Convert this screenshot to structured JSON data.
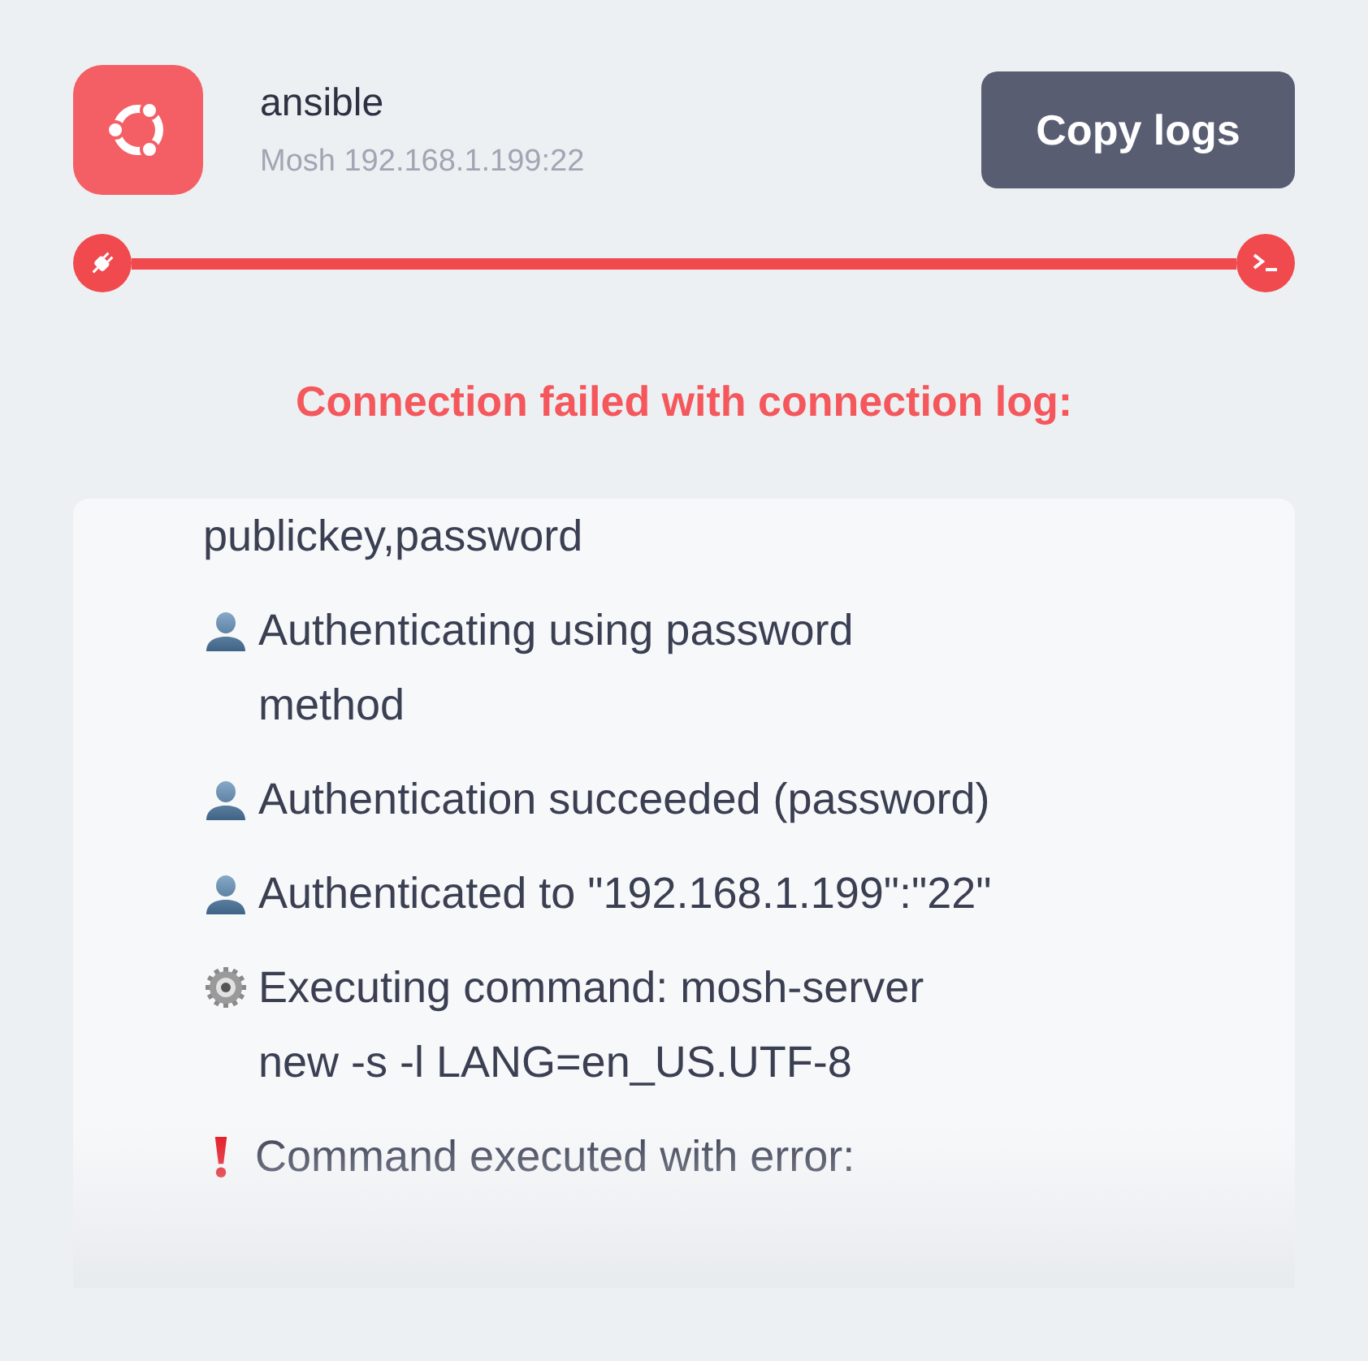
{
  "host": {
    "name": "ansible",
    "address": "Mosh 192.168.1.199:22"
  },
  "copy_button": "Copy logs",
  "status_message": "Connection failed with connection log:",
  "log": [
    {
      "kind": "none",
      "text": "publickey,password"
    },
    {
      "kind": "user",
      "text": "Authenticating using password method"
    },
    {
      "kind": "user",
      "text": "Authentication succeeded (password)"
    },
    {
      "kind": "user",
      "text": "Authenticated to \"192.168.1.199\":\"22\""
    },
    {
      "kind": "gear",
      "text": "Executing command: mosh-server new -s -l LANG=en_US.UTF-8"
    },
    {
      "kind": "error",
      "text": "Command executed with error:"
    }
  ]
}
